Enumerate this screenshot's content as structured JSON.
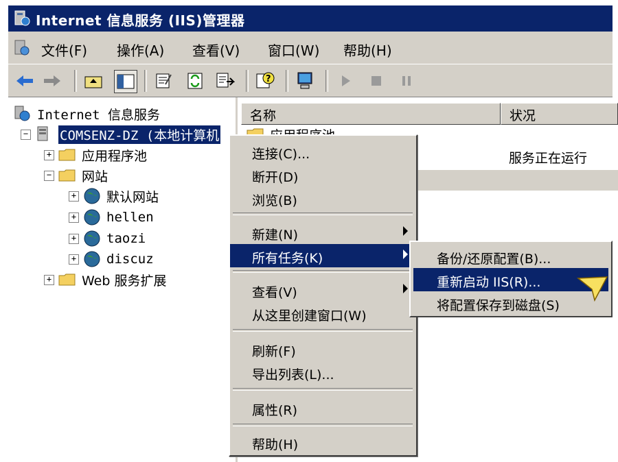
{
  "window": {
    "title": "Internet 信息服务 (IIS)管理器"
  },
  "menubar": {
    "items": [
      "文件(F)",
      "操作(A)",
      "查看(V)",
      "窗口(W)",
      "帮助(H)"
    ]
  },
  "tree": {
    "root": "Internet 信息服务",
    "server": "COMSENZ-DZ (本地计算机",
    "app_pool": "应用程序池",
    "websites": "网站",
    "sites": [
      "默认网站",
      "hellen",
      "taozi",
      "discuz"
    ],
    "web_ext": "Web 服务扩展"
  },
  "list": {
    "columns": [
      "名称",
      "状况"
    ],
    "rows": [
      {
        "name": "应用程序池",
        "status": ""
      },
      {
        "name": "",
        "status": "服务正在运行"
      },
      {
        "name": "",
        "status": ""
      }
    ]
  },
  "context_menu": {
    "items": [
      "连接(C)...",
      "断开(D)",
      "浏览(B)",
      "新建(N)",
      "所有任务(K)",
      "查看(V)",
      "从这里创建窗口(W)",
      "刷新(F)",
      "导出列表(L)...",
      "属性(R)",
      "帮助(H)"
    ]
  },
  "submenu": {
    "items": [
      "备份/还原配置(B)...",
      "重新启动 IIS(R)...",
      "将配置保存到磁盘(S)"
    ]
  },
  "colors": {
    "titlebar": "#0a246a",
    "selection": "#0a246a",
    "chrome": "#d4d0c8"
  }
}
